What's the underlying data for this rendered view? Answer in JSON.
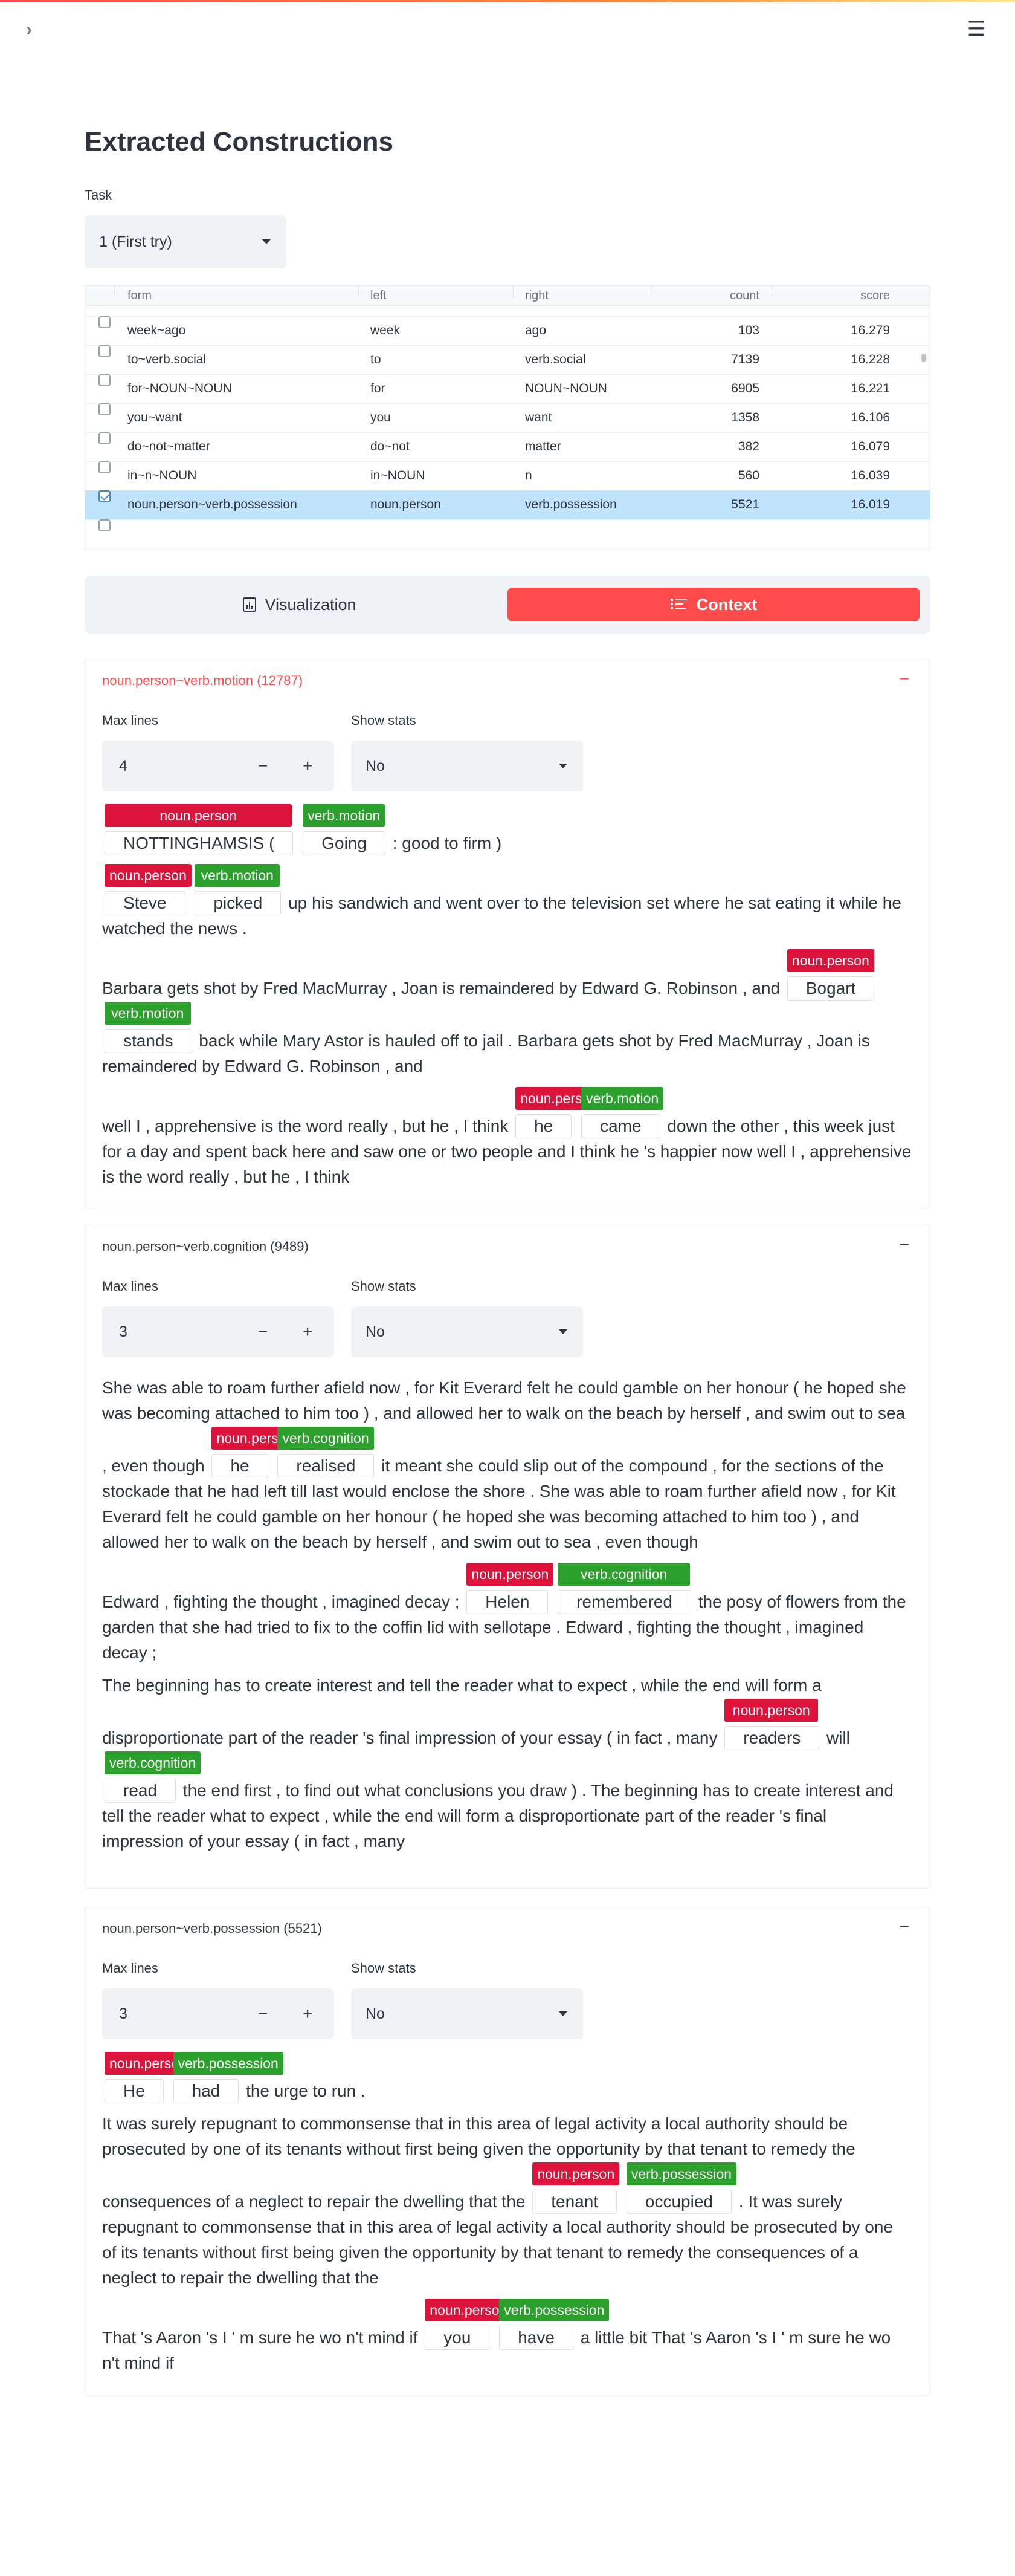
{
  "header": {
    "sidebar_toggle": "›",
    "menu": "☰"
  },
  "page": {
    "title": "Extracted Constructions"
  },
  "task": {
    "label": "Task",
    "value": "1 (First try)"
  },
  "table": {
    "columns": {
      "form": "form",
      "left": "left",
      "right": "right",
      "count": "count",
      "score": "score"
    },
    "rows": [
      {
        "form": "week~ago",
        "left": "week",
        "right": "ago",
        "count": "103",
        "score": "16.279",
        "selected": false
      },
      {
        "form": "to~verb.social",
        "left": "to",
        "right": "verb.social",
        "count": "7139",
        "score": "16.228",
        "selected": false
      },
      {
        "form": "for~NOUN~NOUN",
        "left": "for",
        "right": "NOUN~NOUN",
        "count": "6905",
        "score": "16.221",
        "selected": false
      },
      {
        "form": "you~want",
        "left": "you",
        "right": "want",
        "count": "1358",
        "score": "16.106",
        "selected": false
      },
      {
        "form": "do~not~matter",
        "left": "do~not",
        "right": "matter",
        "count": "382",
        "score": "16.079",
        "selected": false
      },
      {
        "form": "in~n~NOUN",
        "left": "in~NOUN",
        "right": "n",
        "count": "560",
        "score": "16.039",
        "selected": false
      },
      {
        "form": "noun.person~verb.possession",
        "left": "noun.person",
        "right": "verb.possession",
        "count": "5521",
        "score": "16.019",
        "selected": true
      }
    ]
  },
  "tabs": {
    "visualization": "Visualization",
    "context": "Context"
  },
  "expanders": [
    {
      "title": "noun.person~verb.motion (12787)",
      "max_lines_label": "Max lines",
      "max_lines": "4",
      "show_stats_label": "Show stats",
      "show_stats": "No",
      "contexts": [
        {
          "pre": "",
          "t1": "NOTTINGHAMSIS (",
          "t1_tag": "noun.person",
          "mid": "",
          "t2": "Going",
          "t2_tag": "verb.motion",
          "post": ": good to firm )"
        },
        {
          "pre": "",
          "t1": "Steve",
          "t1_tag": "noun.person",
          "mid": "",
          "t2": "picked",
          "t2_tag": "verb.motion",
          "post": "up his sandwich and went over to the television set where he sat eating it while he watched the news ."
        },
        {
          "pre": "Barbara gets shot by Fred MacMurray , Joan is remaindered by Edward G. Robinson , and",
          "t1": "Bogart",
          "t1_tag": "noun.person",
          "mid": "",
          "t2": "stands",
          "t2_tag": "verb.motion",
          "post": "back while Mary Astor is hauled off to jail . Barbara gets shot by Fred MacMurray , Joan is remaindered by Edward G. Robinson , and"
        },
        {
          "pre": "well I , apprehensive is the word really , but he , I think",
          "t1": "he",
          "t1_tag": "noun.person",
          "mid": "",
          "t2": "came",
          "t2_tag": "verb.motion",
          "post": "down the other , this week just for a day and spent back here and saw one or two people and I think he 's happier now well I , apprehensive is the word really , but he , I think"
        }
      ]
    },
    {
      "title": "noun.person~verb.cognition (9489)",
      "max_lines_label": "Max lines",
      "max_lines": "3",
      "show_stats_label": "Show stats",
      "show_stats": "No",
      "contexts": [
        {
          "pre": "She was able to roam further afield now , for Kit Everard felt he could gamble on her honour ( he hoped she was becoming attached to him too ) , and allowed her to walk on the beach by herself , and swim out to sea , even though",
          "t1": "he",
          "t1_tag": "noun.person",
          "mid": "",
          "t2": "realised",
          "t2_tag": "verb.cognition",
          "post": "it meant she could slip out of the compound , for the sections of the stockade that he had left till last would enclose the shore . She was able to roam further afield now , for Kit Everard felt he could gamble on her honour ( he hoped she was becoming attached to him too ) , and allowed her to walk on the beach by herself , and swim out to sea , even though"
        },
        {
          "pre": "Edward , fighting the thought , imagined decay ;",
          "t1": "Helen",
          "t1_tag": "noun.person",
          "mid": "",
          "t2": "remembered",
          "t2_tag": "verb.cognition",
          "post": "the posy of flowers from the garden that she had tried to fix to the coffin lid with sellotape . Edward , fighting the thought , imagined decay ;"
        },
        {
          "pre": "The beginning has to create interest and tell the reader what to expect , while the end will form a disproportionate part of the reader 's final impression of your essay ( in fact , many",
          "t1": "readers",
          "t1_tag": "noun.person",
          "mid": "will",
          "t2": "read",
          "t2_tag": "verb.cognition",
          "post": "the end first , to find out what conclusions you draw ) . The beginning has to create interest and tell the reader what to expect , while the end will form a disproportionate part of the reader 's final impression of your essay ( in fact , many"
        }
      ]
    },
    {
      "title": "noun.person~verb.possession (5521)",
      "max_lines_label": "Max lines",
      "max_lines": "3",
      "show_stats_label": "Show stats",
      "show_stats": "No",
      "contexts": [
        {
          "pre": "",
          "t1": "He",
          "t1_tag": "noun.person",
          "mid": "",
          "t2": "had",
          "t2_tag": "verb.possession",
          "post": "the urge to run ."
        },
        {
          "pre": "It was surely repugnant to commonsense that in this area of legal activity a local authority should be prosecuted by one of its tenants without first being given the opportunity by that tenant to remedy the consequences of a neglect to repair the dwelling that the",
          "t1": "tenant",
          "t1_tag": "noun.person",
          "mid": "",
          "t2": "occupied",
          "t2_tag": "verb.possession",
          "post": ". It was surely repugnant to commonsense that in this area of legal activity a local authority should be prosecuted by one of its tenants without first being given the opportunity by that tenant to remedy the consequences of a neglect to repair the dwelling that the"
        },
        {
          "pre": "That 's Aaron 's I ' m sure he wo n't mind if",
          "t1": "you",
          "t1_tag": "noun.person",
          "mid": "",
          "t2": "have",
          "t2_tag": "verb.possession",
          "post": "a little bit That 's Aaron 's I ' m sure he wo n't mind if"
        }
      ]
    }
  ],
  "colors": {
    "accent": "#ff4b4b",
    "noun_tag": "#dc143c",
    "verb_tag": "#2ca02c",
    "selected_row": "#bfe3fb"
  }
}
